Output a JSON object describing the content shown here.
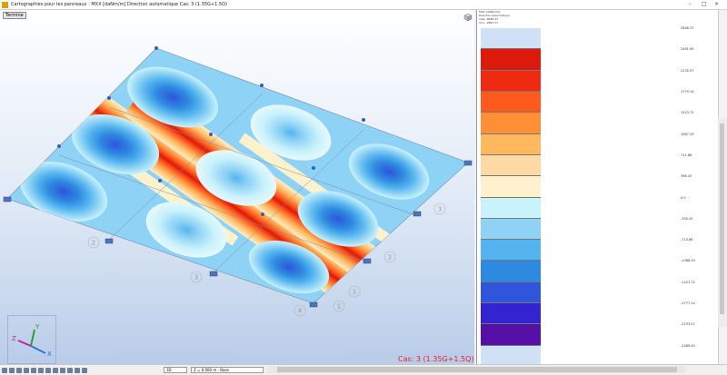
{
  "window": {
    "title": "Cartographies pour les panneaux : MXX [daNm/m] Direction automatique Cas: 3 (1.35G+1.5Q)"
  },
  "viewport": {
    "tab_label": "Termine",
    "case_label": "Cas: 3 (1.35G+1.5Q)",
    "grid_labels": [
      "1",
      "2",
      "3",
      "4",
      "1",
      "2",
      "3"
    ]
  },
  "axes": {
    "x": "X",
    "y": "Y",
    "z": "Z"
  },
  "legend": {
    "info_lines": [
      "MXX [daNm/m]",
      "Direction automatique",
      "max: 2846.37",
      "min: -2847.37"
    ],
    "colors": [
      "#cfe0f7",
      "#dc1a0c",
      "#f02a12",
      "#ff5a1c",
      "#ff8e34",
      "#ffb85e",
      "#ffd9a3",
      "#fff1cc",
      "#c9f2fb",
      "#8ed3f5",
      "#55b4ef",
      "#2e8ae0",
      "#2f55dc",
      "#3423d2",
      "#5610a8",
      "#cfe0f7"
    ],
    "labels": [
      "2846.37",
      "2491.99",
      "2135.57",
      "1779.14",
      "1423.72",
      "1067.29",
      "711.86",
      "356.43",
      "0.0",
      "-355.43",
      "-710.86",
      "-1066.29",
      "-1421.72",
      "-1777.14",
      "-2133.57",
      "-2489.00",
      "-2847.37"
    ]
  },
  "statusbar": {
    "view_label": "3D",
    "level_label": "Z = 0.000 m - Base"
  }
}
